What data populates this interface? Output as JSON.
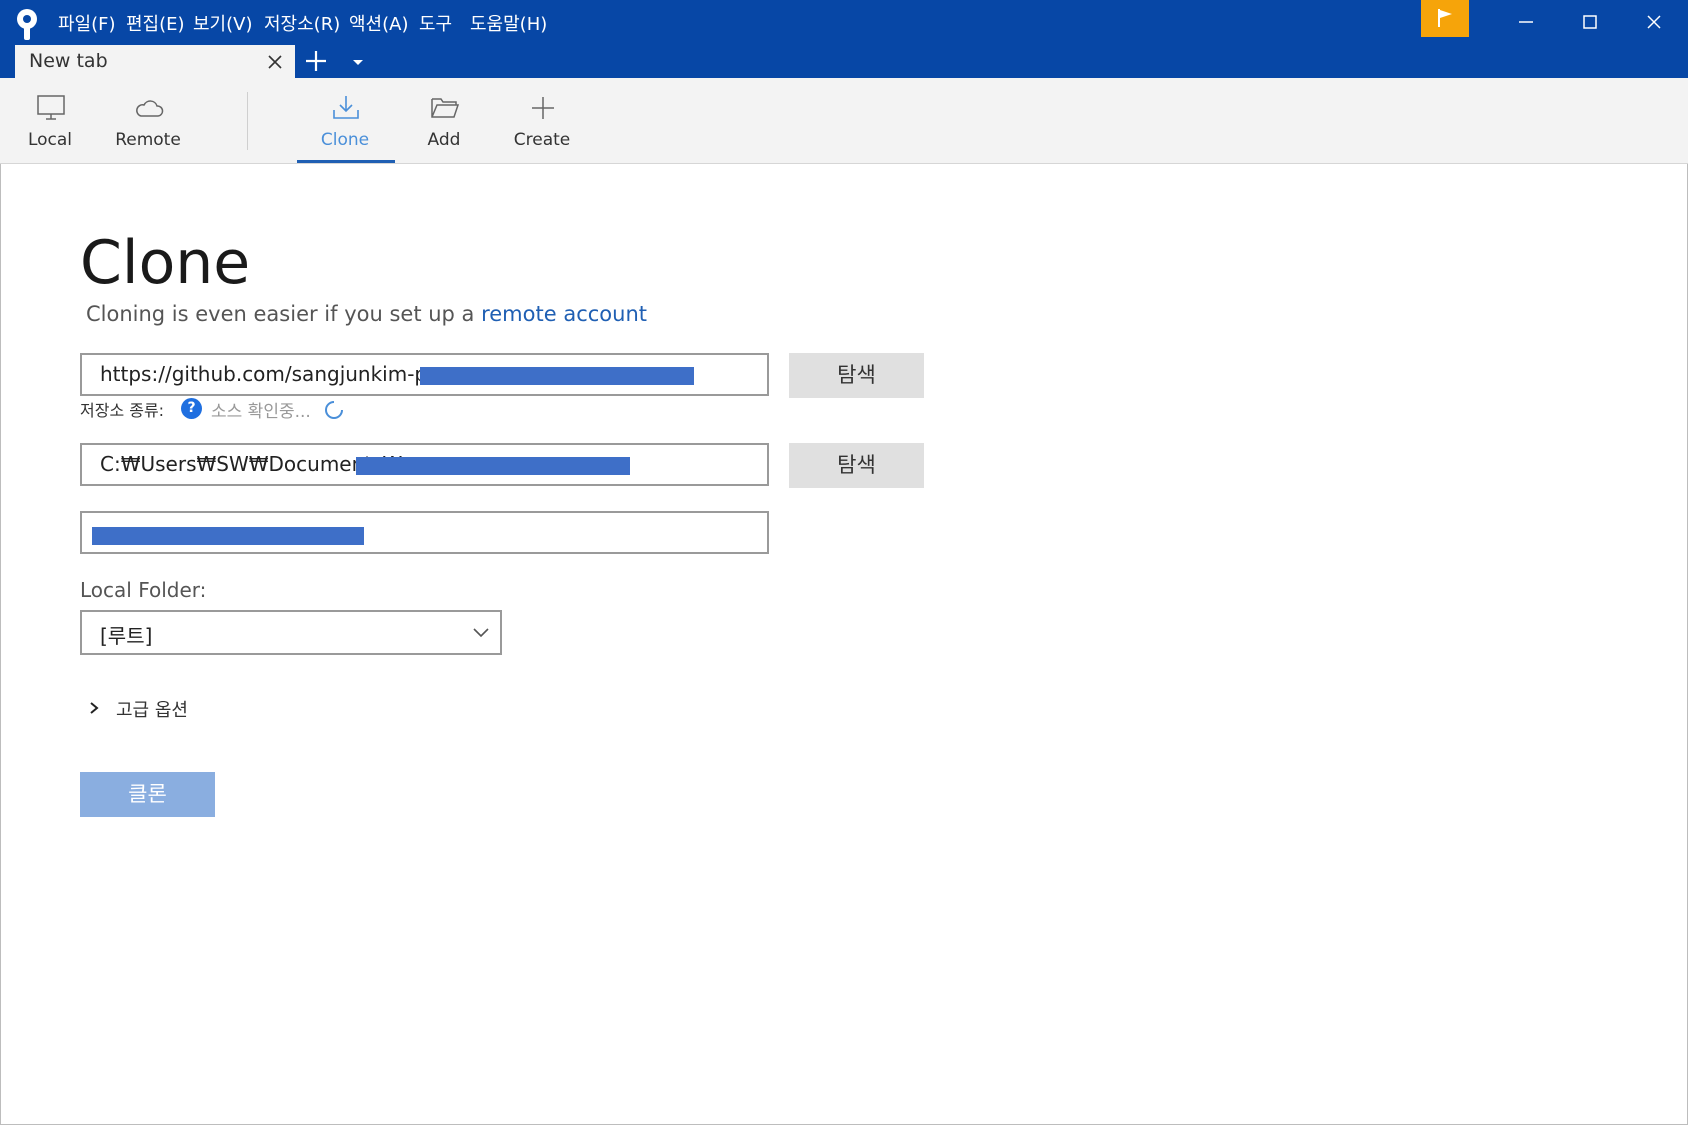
{
  "menu": {
    "items": [
      "파일(F)",
      "편집(E)",
      "보기(V)",
      "저장소(R)",
      "액션(A)",
      "도구",
      "도움말(H)"
    ]
  },
  "tabs": {
    "active_label": "New tab"
  },
  "toolbar": {
    "local_label": "Local",
    "remote_label": "Remote",
    "clone_label": "Clone",
    "add_label": "Add",
    "create_label": "Create"
  },
  "main": {
    "title": "Clone",
    "subtitle_prefix": "Cloning is even easier if you set up a ",
    "subtitle_link": "remote account",
    "source_url": "https://github.com/sangjunkim-p",
    "browse_label": "탐색",
    "repo_type_label": "저장소 종류:",
    "repo_type_status": "소스 확인중...",
    "dest_path": "C:₩Users₩SW₩Documents₩",
    "name_value": "",
    "local_folder_label": "Local Folder:",
    "local_folder_value": "[루트]",
    "advanced_label": "고급 옵션",
    "clone_button": "클론"
  },
  "colors": {
    "titlebar": "#0747a6",
    "flag": "#f6a40a",
    "link": "#1f5fb3",
    "clone_button_disabled": "#8aaee0"
  },
  "icons": [
    "sourcetree-logo-icon",
    "flag-icon",
    "minimize-icon",
    "maximize-icon",
    "close-icon",
    "plus-icon",
    "chevron-down-icon",
    "monitor-icon",
    "cloud-icon",
    "download-icon",
    "folder-open-icon",
    "help-icon",
    "spinner-icon",
    "chevron-right-icon"
  ]
}
